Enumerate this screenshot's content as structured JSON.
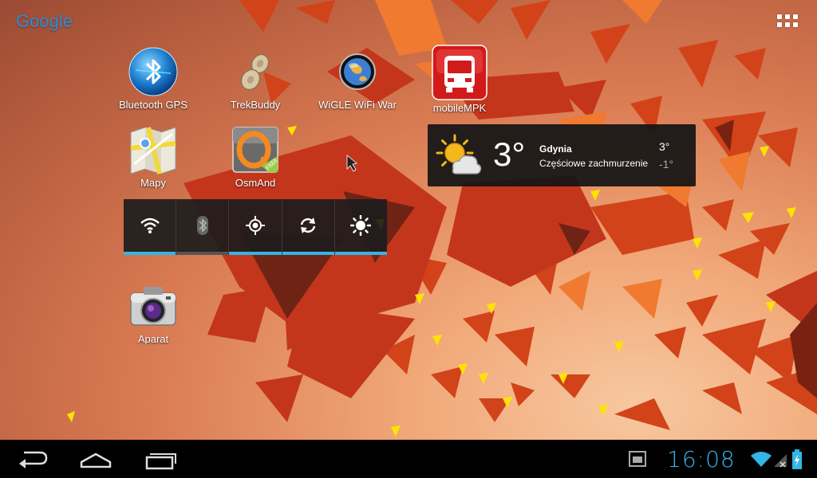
{
  "launcher": {
    "search_label": "Google",
    "apps_button_icon": "apps-grid-icon"
  },
  "apps": [
    {
      "label": "Bluetooth GPS",
      "icon": "bluetooth-gps-icon"
    },
    {
      "label": "TrekBuddy",
      "icon": "trekbuddy-icon"
    },
    {
      "label": "WiGLE WiFi War",
      "icon": "wigle-globe-icon"
    },
    {
      "label": "mobileMPK",
      "icon": "bus-icon"
    },
    {
      "label": "Mapy",
      "icon": "maps-icon"
    },
    {
      "label": "OsmAnd",
      "icon": "osmand-icon"
    },
    {
      "label": "Aparat",
      "icon": "camera-icon"
    }
  ],
  "power_widget": {
    "toggles": [
      {
        "name": "wifi",
        "icon": "wifi-icon",
        "state": "on"
      },
      {
        "name": "bluetooth",
        "icon": "bluetooth-icon",
        "state": "off"
      },
      {
        "name": "gps",
        "icon": "gps-icon",
        "state": "on"
      },
      {
        "name": "sync",
        "icon": "sync-icon",
        "state": "on"
      },
      {
        "name": "brightness",
        "icon": "brightness-icon",
        "state": "on"
      }
    ],
    "on_color": "#33b5e5",
    "off_color": "#555555"
  },
  "weather": {
    "temperature": "3°",
    "city": "Gdynia",
    "condition": "Częściowe zachmurzenie",
    "high": "3°",
    "low": "-1°",
    "icon": "partly-cloudy-icon"
  },
  "navbar": {
    "back_icon": "back-icon",
    "home_icon": "home-icon",
    "recents_icon": "recent-apps-icon"
  },
  "status_bar": {
    "time": "16:08",
    "accent_color": "#33b5e5",
    "notification_icon": "screenshot-notification-icon",
    "wifi_icon": "wifi-signal-icon",
    "signal_icon": "no-signal-icon",
    "battery_icon": "battery-charging-icon"
  }
}
